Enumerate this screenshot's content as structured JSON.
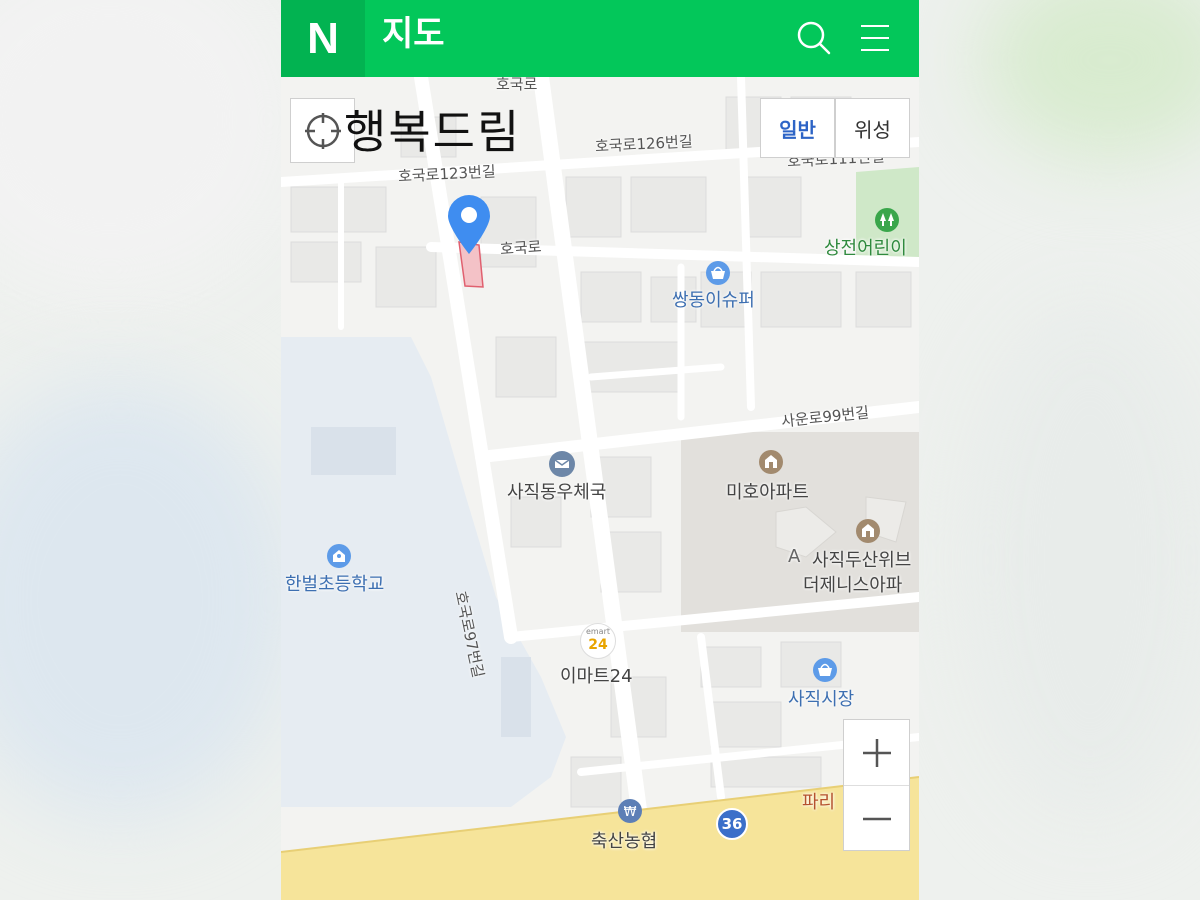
{
  "header": {
    "logo": "N",
    "title": "지도",
    "icons": {
      "search": "search-icon",
      "menu": "menu-icon"
    }
  },
  "overlay": {
    "place_title": "행복드림",
    "locate_icon": "crosshair-icon"
  },
  "map_type": {
    "normal": "일반",
    "satellite": "위성",
    "active": "normal"
  },
  "zoom": {
    "in": "+",
    "out": "−"
  },
  "roads": {
    "r1": "호국로",
    "r2": "호국로126번길",
    "r3": "호국로111번길",
    "r4": "호국로123번길",
    "r5": "호국로",
    "r6": "사운로99번길",
    "r7": "호국로97번길"
  },
  "places": {
    "park": "상전어린이",
    "supermarket": "쌍동이슈퍼",
    "post_office": "사직동우체국",
    "apt1": "미호아파트",
    "apt2_line1": "사직두산위브",
    "apt2_line2": "더제니스아파",
    "school": "한벌초등학교",
    "emart_badge_top": "emart",
    "emart_badge_num": "24",
    "emart": "이마트24",
    "market": "사직시장",
    "bakery": "파리",
    "bank": "축산농협",
    "route_badge": "36",
    "apt_letter": "A"
  },
  "colors": {
    "brand": "#03c75a",
    "marker": "#3f8df0",
    "main_road": "#f6e49a",
    "water": "#e7edf3",
    "park": "#cfe8c8"
  }
}
